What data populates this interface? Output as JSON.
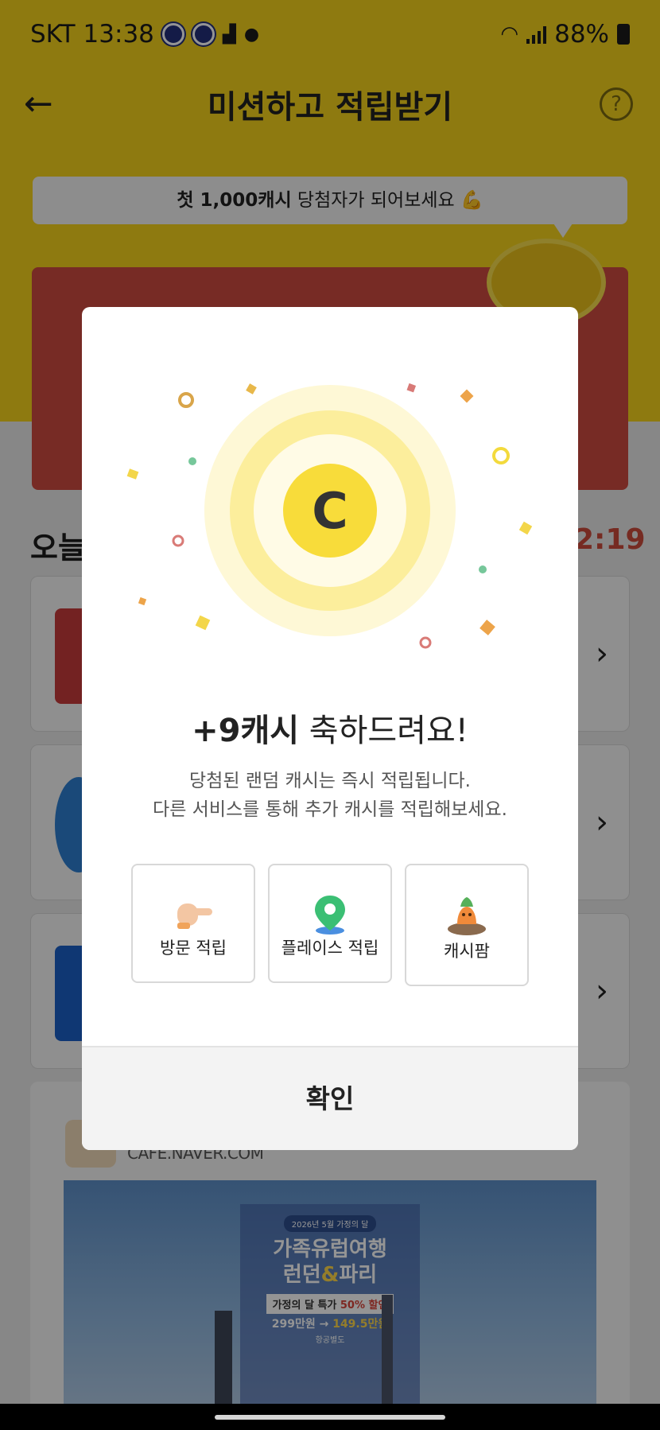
{
  "status_bar": {
    "carrier": "SKT",
    "time": "13:38",
    "battery": "88%"
  },
  "header": {
    "title": "미션하고 적립받기",
    "back_icon": "arrow-left-icon",
    "help_label": "?"
  },
  "promo": {
    "highlight": "첫 1,000캐시",
    "rest": " 당첨자가 되어보세요 💪"
  },
  "section": {
    "heading": "오늘",
    "timer": "2:19"
  },
  "cafe_card": {
    "url": "CAFE.NAVER.COM",
    "ad": {
      "date_label": "2026년 5월 가정의 달",
      "line1": "가족유럽여행",
      "line2_a": "런던",
      "line2_amp": "&",
      "line2_b": "파리",
      "sale_a": "가정의 달 특가 ",
      "sale_pct": "50% 할인",
      "price_old": "299만원 → ",
      "price_new": "149.5만원",
      "note": "항공별도"
    }
  },
  "modal": {
    "title_bold": "+9캐시",
    "title_rest": " 축하드려요!",
    "desc_line1": "당첨된 랜덤 캐시는 즉시 적립됩니다.",
    "desc_line2": "다른 서비스를 통해 추가 캐시를 적립해보세요.",
    "coin_letter": "C",
    "services": [
      {
        "label": "방문 적립",
        "icon": "pointing-hand-icon"
      },
      {
        "label": "플레이스 적립",
        "icon": "map-pin-icon"
      },
      {
        "label": "캐시팜",
        "icon": "carrot-icon"
      }
    ],
    "confirm_label": "확인"
  },
  "colors": {
    "header_yellow": "#f4d21d",
    "coin_yellow": "#f8dc3a",
    "banner_red": "#cd4a40",
    "timer_red": "#cc4b3c"
  }
}
